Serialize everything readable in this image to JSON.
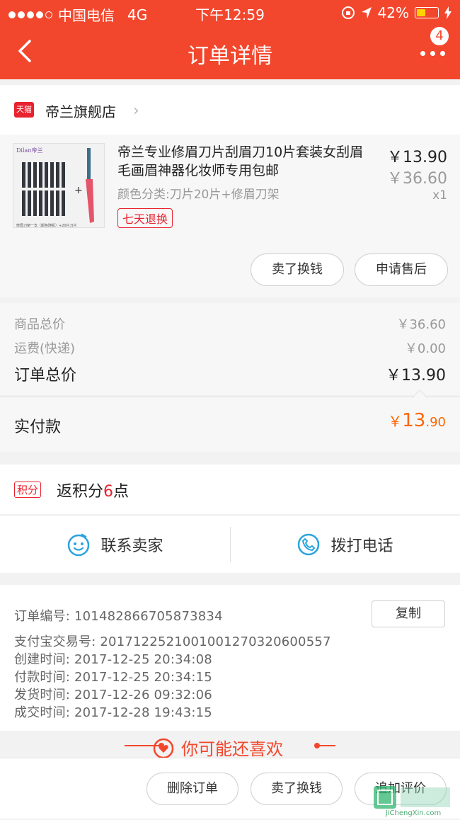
{
  "status_bar": {
    "carrier": "中国电信",
    "network": "4G",
    "time": "下午12:59",
    "battery": "42%"
  },
  "nav": {
    "title": "订单详情",
    "badge": "4"
  },
  "store": {
    "badge": "天猫",
    "name": "帝兰旗舰店"
  },
  "product": {
    "image_brand": "Dilan帝兰",
    "image_caption": "修眉刀架一支（颜色随机）+20片刀片",
    "name": "帝兰专业修眉刀片刮眉刀10片套装女刮眉毛画眉神器化妆师专用包邮",
    "sku": "颜色分类:刀片20片+修眉刀架",
    "tag": "七天退换",
    "price_now": "￥13.90",
    "price_old": "￥36.60",
    "qty": "x1",
    "btn_sell": "卖了换钱",
    "btn_after": "申请售后"
  },
  "summary": {
    "goods_label": "商品总价",
    "goods_value": "￥36.60",
    "ship_label": "运费(快递)",
    "ship_value": "￥0.00",
    "total_label": "订单总价",
    "total_value": "￥13.90",
    "paid_label": "实付款",
    "paid_currency": "￥",
    "paid_int": "13",
    "paid_dec": ".90"
  },
  "points": {
    "badge": "积分",
    "text_pre": "返积分",
    "num": "6",
    "text_post": "点"
  },
  "contact": {
    "seller": "联系卖家",
    "phone": "拨打电话"
  },
  "order_info": {
    "order_no": "订单编号:  101482866705873834",
    "copy": "复制",
    "alipay_no": "支付宝交易号:  2017122521001001270320600557",
    "created": "创建时间:  2017-12-25 20:34:08",
    "paid": "付款时间:  2017-12-25 20:34:15",
    "shipped": "发货时间:  2017-12-26 09:32:06",
    "done": "成交时间:  2017-12-28 19:43:15"
  },
  "guess": "你可能还喜欢",
  "bottom": {
    "delete": "删除订单",
    "sell": "卖了换钱",
    "review": "追加评价"
  },
  "watermark": {
    "site": "JiChengXin.com"
  },
  "colors": {
    "brand": "#f3472d",
    "price": "#ff6600"
  }
}
